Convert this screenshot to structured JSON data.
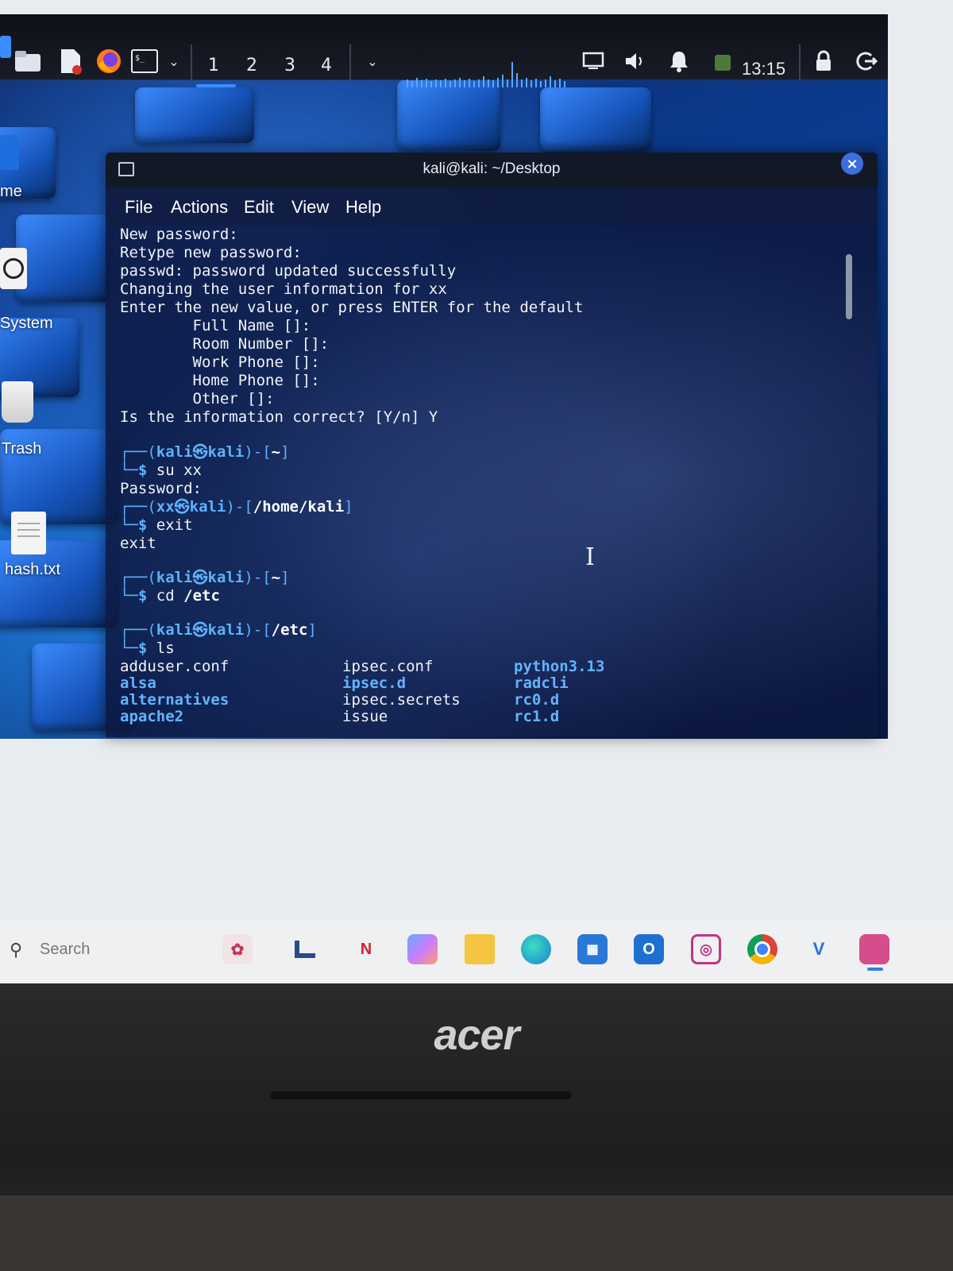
{
  "kali_panel": {
    "workspaces": [
      "1",
      "2",
      "3",
      "4"
    ],
    "active_workspace": "1",
    "clock": "13:15",
    "icons": [
      "file-manager-icon",
      "text-editor-icon",
      "firefox-icon",
      "terminal-icon",
      "display-icon",
      "volume-icon",
      "bell-icon",
      "lock-icon",
      "logout-icon"
    ]
  },
  "desktop": {
    "icons": [
      {
        "label": "me"
      },
      {
        "label": "System"
      },
      {
        "label": "Trash"
      },
      {
        "label": "hash.txt"
      }
    ]
  },
  "terminal": {
    "title": "kali@kali: ~/Desktop",
    "menu": [
      "File",
      "Actions",
      "Edit",
      "View",
      "Help"
    ],
    "lines": {
      "l1": "New password:",
      "l2": "Retype new password:",
      "l3": "passwd: password updated successfully",
      "l4": "Changing the user information for xx",
      "l5": "Enter the new value, or press ENTER for the default",
      "l6": "        Full Name []:",
      "l7": "        Room Number []:",
      "l8": "        Work Phone []:",
      "l9": "        Home Phone []:",
      "l10": "        Other []:",
      "l11": "Is the information correct? [Y/n] Y"
    },
    "prompts": [
      {
        "user": "kali",
        "host": "kali",
        "path": "~",
        "command": "su xx"
      },
      {
        "user": "xx",
        "host": "kali",
        "path": "/home/kali",
        "command": "exit"
      },
      {
        "user": "kali",
        "host": "kali",
        "path": "~",
        "command": "cd",
        "arg": "/etc"
      },
      {
        "user": "kali",
        "host": "kali",
        "path": "/etc",
        "command": "ls"
      }
    ],
    "password_line": "Password:",
    "exit_output": "exit",
    "ls_columns": [
      [
        {
          "name": "adduser.conf",
          "dir": false
        },
        {
          "name": "alsa",
          "dir": true
        },
        {
          "name": "alternatives",
          "dir": true
        },
        {
          "name": "apache2",
          "dir": true
        }
      ],
      [
        {
          "name": "ipsec.conf",
          "dir": false
        },
        {
          "name": "ipsec.d",
          "dir": true
        },
        {
          "name": "ipsec.secrets",
          "dir": false
        },
        {
          "name": "issue",
          "dir": false
        }
      ],
      [
        {
          "name": "python3.13",
          "dir": true
        },
        {
          "name": "radcli",
          "dir": true
        },
        {
          "name": "rc0.d",
          "dir": true
        },
        {
          "name": "rc1.d",
          "dir": true
        }
      ]
    ]
  },
  "host_taskbar": {
    "search_placeholder": "Search",
    "apps": [
      "copilot-app-icon",
      "app-icon",
      "n-app-icon",
      "widgets-icon",
      "file-explorer-icon",
      "edge-icon",
      "store-icon",
      "outlook-icon",
      "instagram-icon",
      "chrome-icon",
      "vs-app-icon",
      "virtualbox-icon"
    ]
  },
  "laptop": {
    "brand": "acer"
  }
}
